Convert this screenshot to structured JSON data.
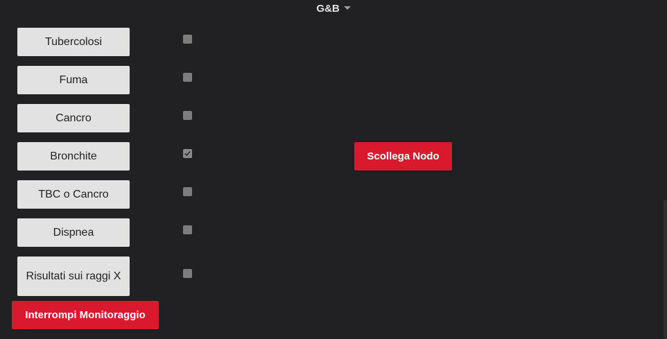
{
  "header": {
    "title": "G&B"
  },
  "nodes": [
    {
      "label": "Tubercolosi",
      "checked": false
    },
    {
      "label": "Fuma",
      "checked": false
    },
    {
      "label": "Cancro",
      "checked": false
    },
    {
      "label": "Bronchite",
      "checked": true
    },
    {
      "label": "TBC o Cancro",
      "checked": false
    },
    {
      "label": "Dispnea",
      "checked": false
    },
    {
      "label": "Risultati sui raggi X",
      "checked": false
    }
  ],
  "actions": {
    "stop_monitoring": "Interrompi Monitoraggio",
    "disconnect_node": "Scollega Nodo"
  },
  "colors": {
    "background": "#212124",
    "button_gray": "#e2e2e2",
    "accent_red": "#d8192e"
  }
}
